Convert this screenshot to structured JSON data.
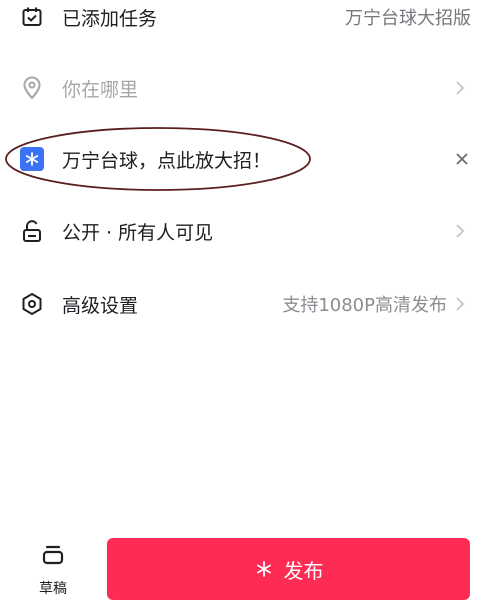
{
  "rows": {
    "task": {
      "label": "已添加任务",
      "value": "万宁台球大招版",
      "icon": "calendar-check-icon"
    },
    "location": {
      "label": "你在哪里",
      "icon": "location-pin-icon"
    },
    "promo": {
      "label": "万宁台球，点此放大招！",
      "icon": "sparkle-badge-icon"
    },
    "visibility": {
      "label": "公开 · 所有人可见",
      "icon": "unlock-icon"
    },
    "advanced": {
      "label": "高级设置",
      "value": "支持1080P高清发布",
      "icon": "hexagon-settings-icon"
    }
  },
  "bottom": {
    "drafts_label": "草稿",
    "publish_label": "发布"
  },
  "colors": {
    "publish_bg": "#fe2c55",
    "promo_icon_bg": "#3a73f5",
    "annotation_ellipse": "#5a1e1e",
    "muted_text": "#8c8c92"
  }
}
